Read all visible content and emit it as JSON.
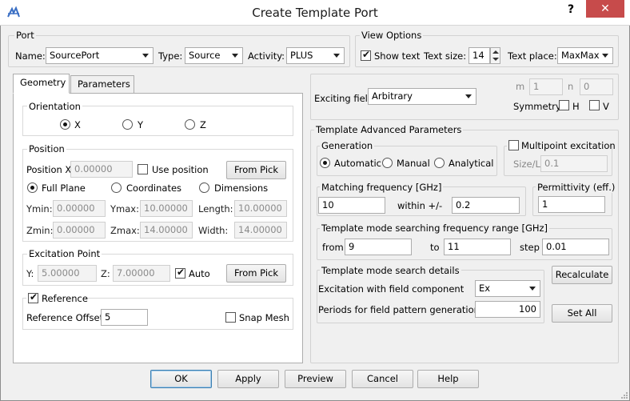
{
  "window": {
    "title": "Create Template Port",
    "help": "?",
    "close": "✕"
  },
  "port": {
    "group_label": "Port",
    "name_label": "Name:",
    "name_value": "SourcePort",
    "type_label": "Type:",
    "type_value": "Source",
    "activity_label": "Activity:",
    "activity_value": "PLUS"
  },
  "view_options": {
    "group_label": "View Options",
    "show_text_label": "Show text",
    "text_size_label": "Text size:",
    "text_size_value": "14",
    "text_place_label": "Text place:",
    "text_place_value": "MaxMax"
  },
  "tabs": [
    {
      "label": "Geometry"
    },
    {
      "label": "Parameters"
    }
  ],
  "geometry": {
    "orientation": {
      "label": "Orientation",
      "options": [
        "X",
        "Y",
        "Z"
      ],
      "selected": "X"
    },
    "position": {
      "label": "Position",
      "position_x_label": "Position X",
      "position_x_value": "0.00000",
      "use_position_label": "Use position",
      "from_pick_label": "From Pick",
      "plane_options": [
        "Full Plane",
        "Coordinates",
        "Dimensions"
      ],
      "plane_selected": "Full Plane",
      "ymin_label": "Ymin:",
      "ymin_value": "0.00000",
      "ymax_label": "Ymax:",
      "ymax_value": "10.00000",
      "length_label": "Length:",
      "length_value": "10.00000",
      "zmin_label": "Zmin:",
      "zmin_value": "0.00000",
      "zmax_label": "Zmax:",
      "zmax_value": "14.00000",
      "width_label": "Width:",
      "width_value": "14.00000"
    },
    "excitation_point": {
      "label": "Excitation Point",
      "y_label": "Y:",
      "y_value": "5.00000",
      "z_label": "Z:",
      "z_value": "7.00000",
      "auto_label": "Auto",
      "from_pick_label": "From Pick"
    },
    "reference": {
      "label": "Reference",
      "offset_label": "Reference Offset",
      "offset_value": "5",
      "snap_mesh_label": "Snap Mesh"
    }
  },
  "exciting": {
    "exciting_field_label": "Exciting field",
    "exciting_field_value": "Arbitrary",
    "m_label": "m",
    "m_value": "1",
    "n_label": "n",
    "n_value": "0",
    "symmetry_label": "Symmetry",
    "h_label": "H",
    "v_label": "V"
  },
  "advanced": {
    "label": "Template Advanced Parameters",
    "generation": {
      "label": "Generation",
      "options": [
        "Automatic",
        "Manual",
        "Analytical"
      ],
      "selected": "Automatic"
    },
    "multipoint": {
      "label": "Multipoint excitation",
      "sizel_label": "Size/L",
      "sizel_value": "0.1"
    },
    "matching": {
      "label": "Matching frequency [GHz]",
      "value": "10",
      "within_label": "within +/-",
      "within_value": "0.2"
    },
    "permittivity": {
      "label": "Permittivity (eff.)",
      "value": "1"
    },
    "search_range": {
      "label": "Template mode searching frequency range [GHz]",
      "from_label": "from",
      "from_value": "9",
      "to_label": "to",
      "to_value": "11",
      "step_label": "step",
      "step_value": "0.01"
    },
    "search_details": {
      "label": "Template mode search details",
      "component_label": "Excitation with field component",
      "component_value": "Ex",
      "periods_label": "Periods for field pattern generation",
      "periods_value": "100"
    },
    "recalculate_label": "Recalculate",
    "set_all_label": "Set All"
  },
  "buttons": {
    "ok": "OK",
    "apply": "Apply",
    "preview": "Preview",
    "cancel": "Cancel",
    "help": "Help"
  }
}
